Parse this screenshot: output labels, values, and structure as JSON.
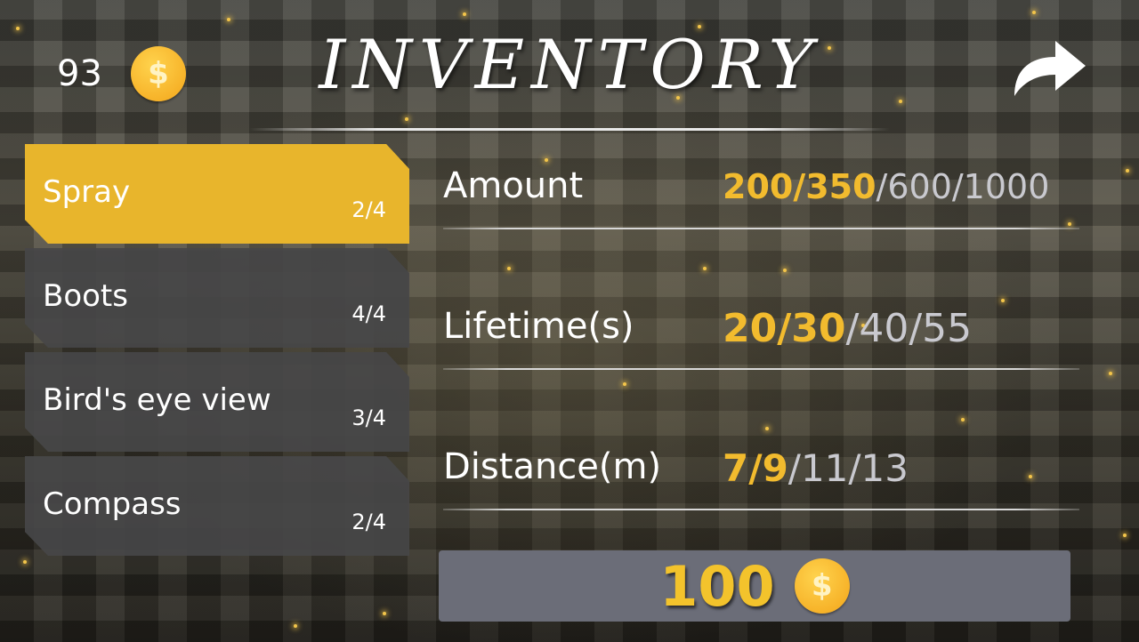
{
  "header": {
    "coin_count": "93",
    "title": "INVENTORY",
    "currency_symbol": "$",
    "back_icon": "curved-arrow-icon"
  },
  "items": [
    {
      "name": "Spray",
      "level": "2/4",
      "selected": true
    },
    {
      "name": "Boots",
      "level": "4/4",
      "selected": false
    },
    {
      "name": "Bird's eye view",
      "level": "3/4",
      "selected": false
    },
    {
      "name": "Compass",
      "level": "2/4",
      "selected": false
    }
  ],
  "stats": [
    {
      "label": "Amount",
      "unlocked": "200/350",
      "locked": "/600/1000"
    },
    {
      "label": "Lifetime(s)",
      "unlocked": "20/30",
      "locked": "/40/55"
    },
    {
      "label": "Distance(m)",
      "unlocked": "7/9",
      "locked": "/11/13"
    }
  ],
  "buy": {
    "price": "100",
    "currency_symbol": "$"
  },
  "colors": {
    "accent": "#e8b52c",
    "highlight_value": "#f2bb2e",
    "panel": "#464648",
    "button": "#6b6d78"
  }
}
